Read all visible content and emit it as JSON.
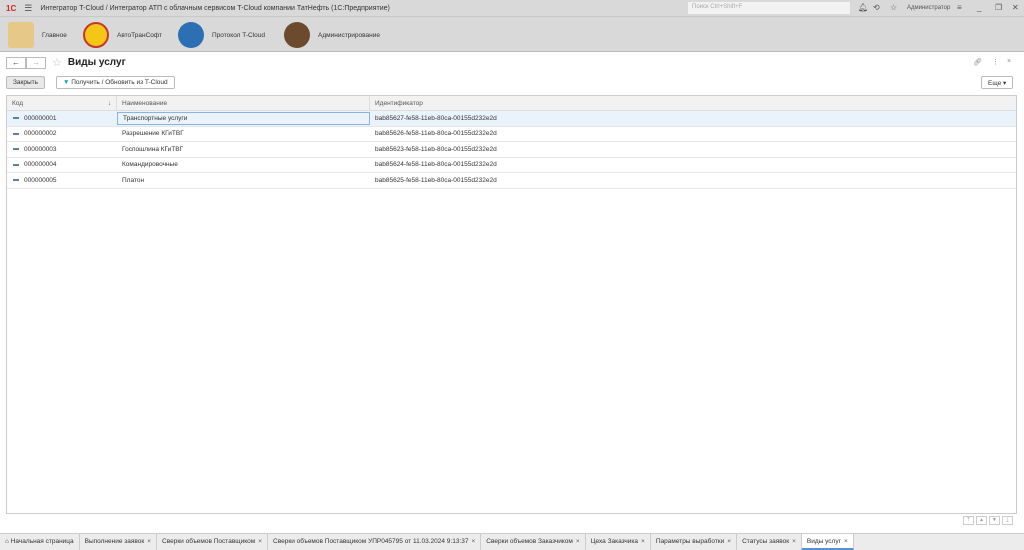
{
  "window": {
    "logo": "1С",
    "title": "Интегратор T-Cloud / Интегратор АТП с облачным сервисом T-Cloud компании ТатНефть  (1С:Предприятие)",
    "search_placeholder": "Поиск Ctrl+Shift+F",
    "user": "Администратор"
  },
  "sections": [
    {
      "label": "Главное"
    },
    {
      "label": "АвтоТранСофт"
    },
    {
      "label": "Протокол T-Cloud"
    },
    {
      "label": "Администрирование"
    }
  ],
  "form": {
    "title": "Виды услуг",
    "close_label": "Закрыть",
    "fetch_label": "Получить / Обновить из T-Cloud",
    "more_label": "Еще"
  },
  "table": {
    "headers": [
      "Код",
      "Наименование",
      "Идентификатор"
    ],
    "rows": [
      {
        "code": "000000001",
        "name": "Транспортные услуги",
        "id": "bab85627-fe58-11eb-80ca-00155d232e2d"
      },
      {
        "code": "000000002",
        "name": "Разрешение КГиТВГ",
        "id": "bab85626-fe58-11eb-80ca-00155d232e2d"
      },
      {
        "code": "000000003",
        "name": "Госпошлина КГиТВГ",
        "id": "bab85623-fe58-11eb-80ca-00155d232e2d"
      },
      {
        "code": "000000004",
        "name": "Командировочные",
        "id": "bab85624-fe58-11eb-80ca-00155d232e2d"
      },
      {
        "code": "000000005",
        "name": "Платон",
        "id": "bab85625-fe58-11eb-80ca-00155d232e2d"
      }
    ]
  },
  "tabs": [
    {
      "label": "Начальная страница"
    },
    {
      "label": "Выполнение заявок"
    },
    {
      "label": "Сверки объемов Поставщиком"
    },
    {
      "label": "Сверки объемов Поставщиком УПР045795 от 11.03.2024 9:13:37"
    },
    {
      "label": "Сверки объемов Заказчиком"
    },
    {
      "label": "Цеха Заказчика"
    },
    {
      "label": "Параметры выработки"
    },
    {
      "label": "Статусы заявок"
    },
    {
      "label": "Виды услуг"
    }
  ]
}
